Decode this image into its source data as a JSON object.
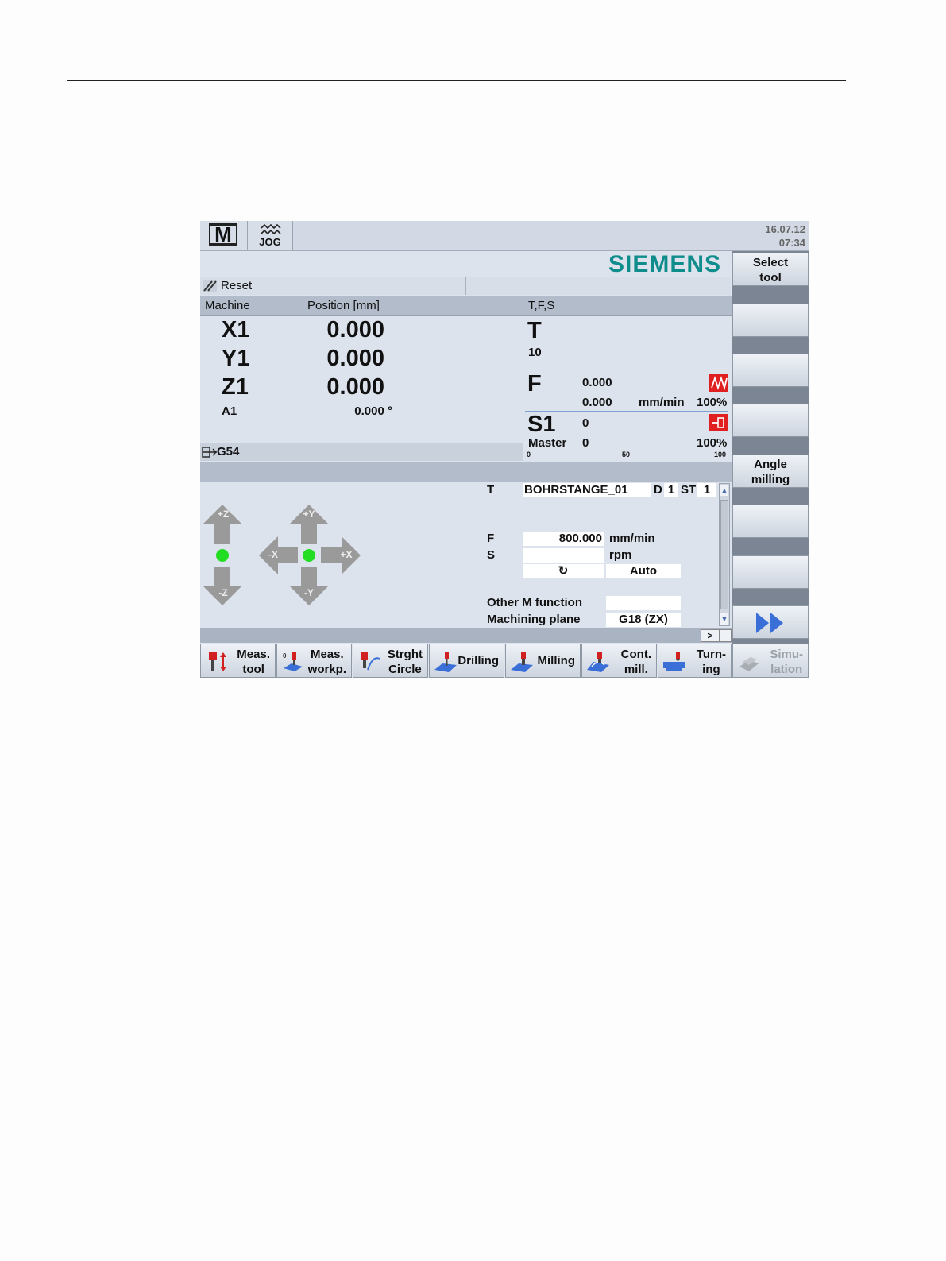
{
  "top": {
    "mode_label": "M",
    "jog_label": "JOG",
    "date": "16.07.12",
    "time": "07:34"
  },
  "brand": "SIEMENS",
  "status": {
    "reset_label": "Reset"
  },
  "position": {
    "col_machine": "Machine",
    "col_position": "Position [mm]",
    "axes": [
      {
        "name": "X1",
        "value": "0.000"
      },
      {
        "name": "Y1",
        "value": "0.000"
      },
      {
        "name": "Z1",
        "value": "0.000"
      }
    ],
    "rot_axis": {
      "name": "A1",
      "value": "0.000 °"
    },
    "work_offset": "G54"
  },
  "tfs": {
    "header": "T,F,S",
    "t_label": "T",
    "t_value": "10",
    "f_label": "F",
    "f_value": "0.000",
    "f_value2": "0.000",
    "f_unit": "mm/min",
    "f_override": "100%",
    "s_label": "S1",
    "s_value": "0",
    "s_master_label": "Master",
    "s_master_value": "0",
    "s_override": "100%",
    "scale_0": "0",
    "scale_50": "50",
    "scale_100": "100"
  },
  "jog": {
    "z_plus": "+Z",
    "z_minus": "-Z",
    "y_plus": "+Y",
    "y_minus": "-Y",
    "x_plus": "+X",
    "x_minus": "-X"
  },
  "params": {
    "t_label": "T",
    "tool_name": "BOHRSTANGE_01",
    "d_label": "D",
    "d_value": "1",
    "st_label": "ST",
    "st_value": "1",
    "f_label": "F",
    "f_value": "800.000",
    "f_unit": "mm/min",
    "s_label": "S",
    "s_value": "",
    "s_unit": "rpm",
    "dir_symbol": "↻",
    "mode_value": "Auto",
    "other_m_label": "Other M function",
    "other_m_value": "",
    "plane_label": "Machining plane",
    "plane_value": "G18 (ZX)",
    "more_symbol": ">"
  },
  "vertical_softkeys": [
    {
      "label": "Select\ntool"
    },
    {
      "label": ""
    },
    {
      "label": ""
    },
    {
      "label": ""
    },
    {
      "label": "Angle\nmilling"
    },
    {
      "label": ""
    },
    {
      "label": ""
    }
  ],
  "horizontal_softkeys": [
    {
      "label": "Meas.\ntool"
    },
    {
      "label": "Meas.\nworkp."
    },
    {
      "label": "Strght\nCircle"
    },
    {
      "label": "Drilling"
    },
    {
      "label": "Milling"
    },
    {
      "label": "Cont.\nmill."
    },
    {
      "label": "Turn-\ning"
    },
    {
      "label": "Simu-\nlation"
    }
  ],
  "colors": {
    "brand": "#0f8c8c",
    "alarm_red": "#e02020",
    "jog_green": "#22dd22",
    "arrow_gray": "#9a9a9a"
  }
}
